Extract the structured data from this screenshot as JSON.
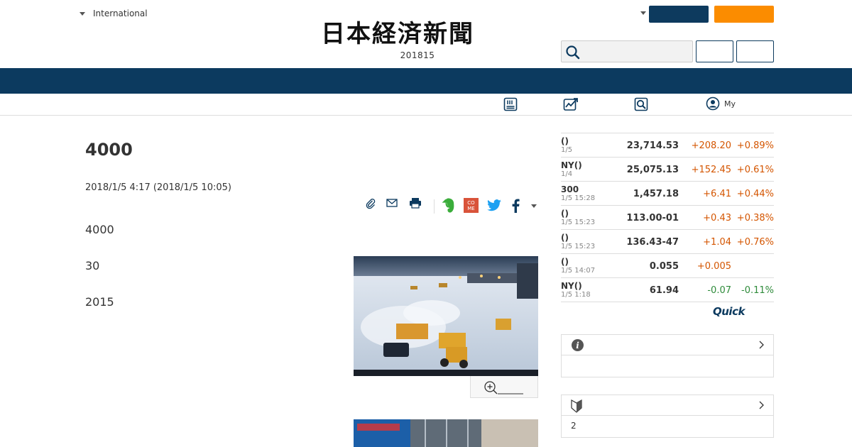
{
  "header": {
    "international_label": "International",
    "logo_text": "日本経済新聞",
    "logo_date": "201815"
  },
  "subnav": {
    "my_label": "My"
  },
  "article": {
    "title": "4000",
    "date": "2018/1/5 4:17 (2018/1/5 10:05)",
    "paragraphs": [
      "4000",
      "30",
      "2015"
    ]
  },
  "market": {
    "rows": [
      {
        "name": "()",
        "time": "1/5",
        "value": "23,714.53",
        "change": "+208.20",
        "pct": "+0.89%",
        "dir": "up"
      },
      {
        "name": "NY()",
        "time": "1/4",
        "value": "25,075.13",
        "change": "+152.45",
        "pct": "+0.61%",
        "dir": "up"
      },
      {
        "name": "300",
        "time": "1/5 15:28",
        "value": "1,457.18",
        "change": "+6.41",
        "pct": "+0.44%",
        "dir": "up"
      },
      {
        "name": "()",
        "time": "1/5 15:23",
        "value": "113.00-01",
        "change": "+0.43",
        "pct": "+0.38%",
        "dir": "up"
      },
      {
        "name": "()",
        "time": "1/5 15:23",
        "value": "136.43-47",
        "change": "+1.04",
        "pct": "+0.76%",
        "dir": "up"
      },
      {
        "name": "()",
        "time": "1/5 14:07",
        "value": "0.055",
        "change": "+0.005",
        "pct": "",
        "dir": "up"
      },
      {
        "name": "NY()",
        "time": "1/5 1:18",
        "value": "61.94",
        "change": "-0.07",
        "pct": "-0.11%",
        "dir": "down"
      }
    ],
    "provider": "Quick"
  },
  "panels": {
    "second_body": "2"
  },
  "colors": {
    "navy": "#0c3a5f",
    "orange": "#fb8c00",
    "up": "#d45500",
    "down": "#2e8b3a"
  }
}
